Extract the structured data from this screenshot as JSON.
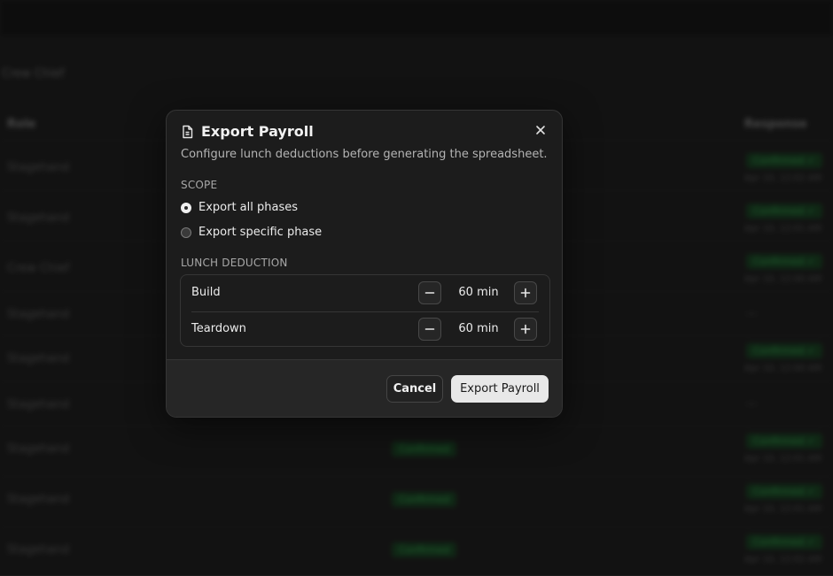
{
  "background": {
    "breadcrumb": "Crew Chief",
    "columns": {
      "role": "Role",
      "response": "Response"
    },
    "rows": [
      {
        "role": "Stagehand",
        "mid_status": "",
        "status": "Confirmed ✓",
        "time": "Apr 10, 12:02 AM"
      },
      {
        "role": "Stagehand",
        "mid_status": "",
        "status": "Confirmed ✓",
        "time": "Apr 10, 12:01 AM"
      },
      {
        "role": "Crew Chief",
        "mid_status": "",
        "status": "Confirmed ✓",
        "time": "Apr 10, 12:00 AM"
      },
      {
        "role": "Stagehand",
        "mid_status": "",
        "status": "",
        "time": "",
        "dash": "—"
      },
      {
        "role": "Stagehand",
        "mid_status": "",
        "status": "Confirmed ✓",
        "time": "Apr 10, 12:00 AM"
      },
      {
        "role": "Stagehand",
        "mid_status": "",
        "status": "",
        "time": "",
        "dash": "—"
      },
      {
        "role": "Stagehand",
        "mid_status": "Confirmed",
        "status": "Confirmed ✓",
        "time": "Apr 10, 12:01 AM"
      },
      {
        "role": "Stagehand",
        "mid_status": "Confirmed",
        "status": "Confirmed ✓",
        "time": "Apr 10, 12:01 AM"
      },
      {
        "role": "Stagehand",
        "mid_status": "Confirmed",
        "status": "Confirmed ✓",
        "time": "Apr 10, 12:02 AM"
      }
    ]
  },
  "modal": {
    "title": "Export Payroll",
    "description": "Configure lunch deductions before generating the spreadsheet.",
    "scope_label": "SCOPE",
    "scope_options": [
      {
        "label": "Export all phases",
        "selected": true
      },
      {
        "label": "Export specific phase",
        "selected": false
      }
    ],
    "deduction_label": "LUNCH DEDUCTION",
    "deductions": [
      {
        "phase": "Build",
        "value": "60 min"
      },
      {
        "phase": "Teardown",
        "value": "60 min"
      }
    ],
    "cancel_label": "Cancel",
    "export_label": "Export Payroll",
    "icons": {
      "title": "document-icon",
      "close": "close-icon",
      "decrease": "minus-icon",
      "increase": "plus-icon"
    }
  },
  "colors": {
    "accent_green": "#2f8a45",
    "primary_button": "#e8e8e8",
    "modal_bg": "#1c1c1c"
  }
}
